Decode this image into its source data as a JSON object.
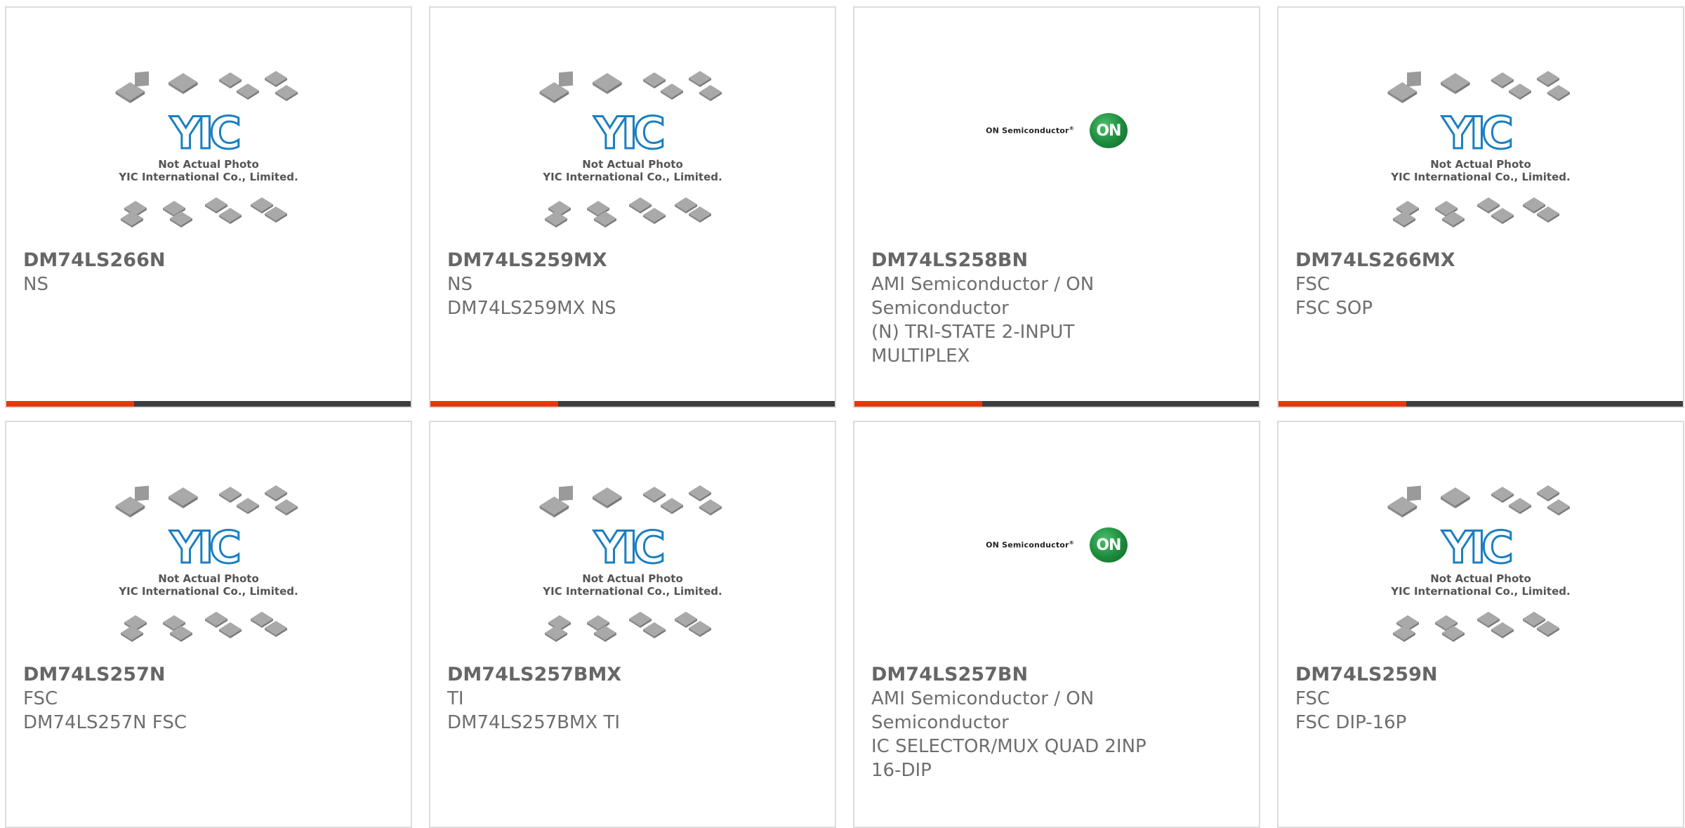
{
  "placeholder_text": {
    "line1": "Not Actual Photo",
    "line2": "YIC International Co., Limited."
  },
  "logo_text": {
    "yic": "YIC",
    "on_semi_name": "ON Semiconductor",
    "on_semi_badge": "ON"
  },
  "colors": {
    "accent": "#e8360c",
    "bar": "#3d3d3d",
    "yic_blue": "#1a7fc1",
    "on_green": "#1c8a3c"
  },
  "products": [
    {
      "part": "DM74LS266N",
      "brand": "NS",
      "desc": [],
      "image": "yic-placeholder"
    },
    {
      "part": "DM74LS259MX",
      "brand": "NS",
      "desc": [
        "DM74LS259MX NS"
      ],
      "image": "yic-placeholder"
    },
    {
      "part": "DM74LS258BN",
      "brand": "AMI Semiconductor / ON Semiconductor",
      "desc": [
        "(N) TRI-STATE 2-INPUT MULTIPLEX"
      ],
      "image": "on-semi-logo"
    },
    {
      "part": "DM74LS266MX",
      "brand": "FSC",
      "desc": [
        "FSC SOP"
      ],
      "image": "yic-placeholder"
    },
    {
      "part": "DM74LS257N",
      "brand": "FSC",
      "desc": [
        "DM74LS257N FSC"
      ],
      "image": "yic-placeholder"
    },
    {
      "part": "DM74LS257BMX",
      "brand": "TI",
      "desc": [
        "DM74LS257BMX TI"
      ],
      "image": "yic-placeholder"
    },
    {
      "part": "DM74LS257BN",
      "brand": "AMI Semiconductor / ON Semiconductor",
      "desc": [
        "IC SELECTOR/MUX QUAD 2INP 16-DIP"
      ],
      "image": "on-semi-logo"
    },
    {
      "part": "DM74LS259N",
      "brand": "FSC",
      "desc": [
        "FSC DIP-16P"
      ],
      "image": "yic-placeholder"
    }
  ]
}
